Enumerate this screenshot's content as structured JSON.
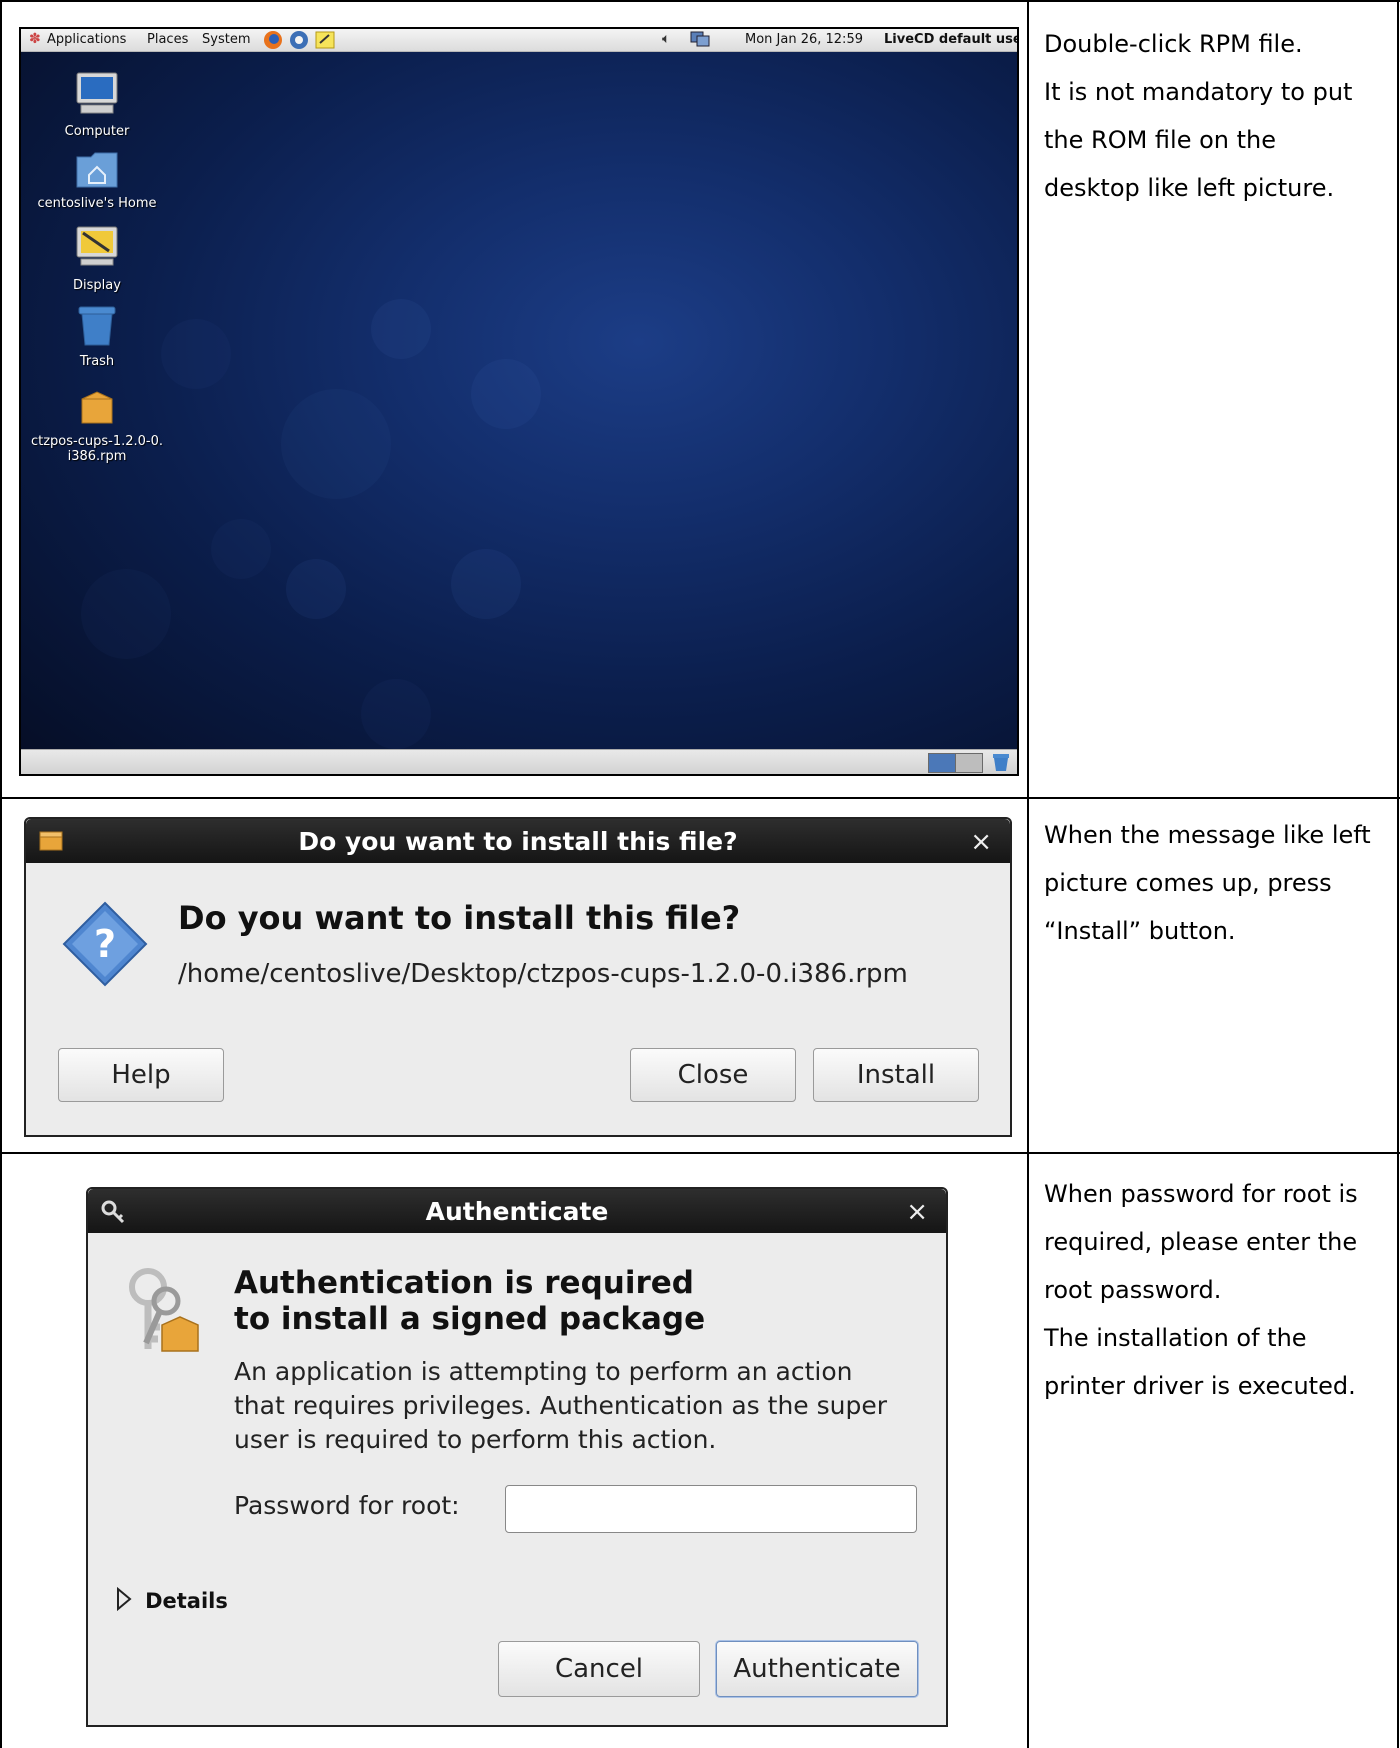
{
  "desktop": {
    "panel": {
      "menus": [
        "Applications",
        "Places",
        "System"
      ],
      "clock": "Mon Jan 26, 12:59",
      "user": "LiveCD default user"
    },
    "icons": [
      {
        "name": "computer-icon",
        "label": "Computer"
      },
      {
        "name": "home-folder-icon",
        "label": "centoslive's Home"
      },
      {
        "name": "display-icon",
        "label": "Display"
      },
      {
        "name": "trash-icon",
        "label": "Trash"
      },
      {
        "name": "rpm-package-icon",
        "label_line1": "ctzpos-cups-1.2.0-0.",
        "label_line2": "i386.rpm"
      }
    ]
  },
  "descriptions": {
    "row1": [
      "Double-click RPM file.",
      "It is not mandatory to put",
      "the ROM file on the",
      "desktop like left picture."
    ],
    "row2": [
      "When the message like left",
      "picture comes up, press",
      "“Install” button."
    ],
    "row3": [
      "When password for root is",
      "required, please enter the",
      "root password.",
      "The installation of the",
      "printer driver is executed."
    ]
  },
  "install_dialog": {
    "title": "Do you want to install this file?",
    "heading": "Do you want to install this file?",
    "path": "/home/centoslive/Desktop/ctzpos-cups-1.2.0-0.i386.rpm",
    "help_label": "Help",
    "close_label": "Close",
    "install_label": "Install"
  },
  "auth_dialog": {
    "title": "Authenticate",
    "heading_line1": "Authentication is required",
    "heading_line2": "to install a signed package",
    "body_line1": "An application is attempting to perform an action",
    "body_line2": "that requires privileges. Authentication as the super",
    "body_line3": "user is required to perform this action.",
    "password_label": "Password for root:",
    "password_value": "",
    "details_label": "Details",
    "cancel_label": "Cancel",
    "authenticate_label": "Authenticate"
  }
}
